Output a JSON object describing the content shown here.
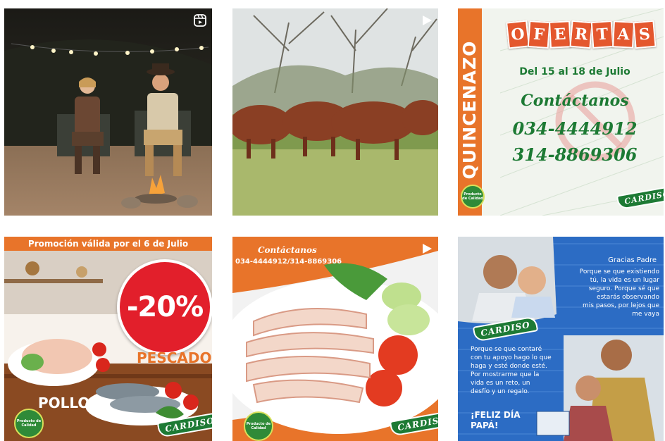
{
  "colors": {
    "orange": "#e8742a",
    "green": "#1d7a34",
    "red": "#e21f2b",
    "blue": "#2c6cc4"
  },
  "grid": {
    "posts": [
      {
        "kind": "reel",
        "icon": "reel-icon"
      },
      {
        "kind": "video",
        "icon": "play-icon"
      },
      {
        "kind": "image",
        "side_text": "QUINCENAZO",
        "title_letters": [
          "O",
          "F",
          "E",
          "R",
          "T",
          "A",
          "S"
        ],
        "dates": "Del 15 al 18 de Julio",
        "contact_label": "Contáctanos",
        "phone1": "034-4444912",
        "phone2": "314-8869306",
        "seal_text": "Producto de Calidad",
        "logo": "CARDISO"
      },
      {
        "kind": "image",
        "banner": "Promoción válida por el 6 de Julio",
        "discount": "-20%",
        "label_fish": "PESCADO",
        "label_chicken": "POLLO",
        "seal_text": "Producto de Calidad",
        "logo": "CARDISO"
      },
      {
        "kind": "video",
        "icon": "play-icon",
        "contact_label": "Contáctanos",
        "phones": "034-4444912/314-8869306",
        "seal_text": "Producto de Calidad",
        "logo": "CARDISO"
      },
      {
        "kind": "image",
        "heading": "Gracias Padre",
        "text_top": [
          "Porque se que existiendo",
          "tú, la vida es un lugar",
          "seguro. Porque sé que",
          "estarás observando",
          "mis pasos, por lejos que",
          "me vaya"
        ],
        "text_bottom": [
          "Porque se que contaré",
          "con tu apoyo hago lo que",
          "haga y esté donde esté.",
          "Por mostrarme que la",
          "vida es un reto, un",
          "desfío y un regalo."
        ],
        "greeting1": "¡FELIZ DÍA",
        "greeting2": "PAPÁ!",
        "logo": "CARDISO"
      }
    ]
  }
}
